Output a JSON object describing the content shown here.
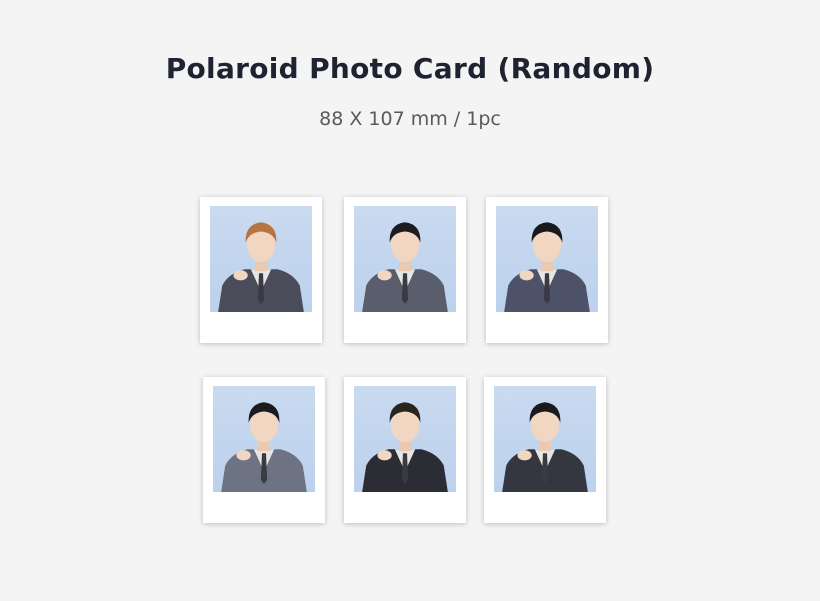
{
  "header": {
    "title": "Polaroid Photo Card (Random)",
    "spec": "88 X 107 mm / 1pc"
  },
  "cards": [
    {
      "photo": "member-portrait-1",
      "suit_color": "#4a4c5a",
      "hair_color": "#b7743f"
    },
    {
      "photo": "member-portrait-2",
      "suit_color": "#5a5d6c",
      "hair_color": "#1c1c22"
    },
    {
      "photo": "member-portrait-3",
      "suit_color": "#4e5268",
      "hair_color": "#18181e"
    },
    {
      "photo": "member-portrait-4",
      "suit_color": "#6d7382",
      "hair_color": "#1a1a20"
    },
    {
      "photo": "member-portrait-5",
      "suit_color": "#2b2c34",
      "hair_color": "#2a2420"
    },
    {
      "photo": "member-portrait-6",
      "suit_color": "#343640",
      "hair_color": "#1a1a1e"
    }
  ]
}
